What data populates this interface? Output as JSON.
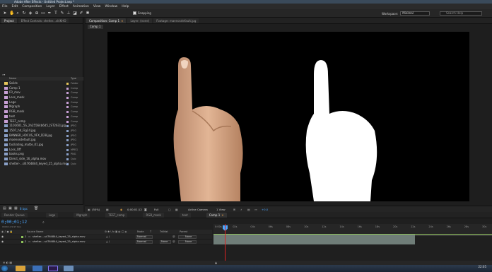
{
  "window": {
    "title": "Adobe After Effects - Untitled Project.aep *"
  },
  "menu": [
    "File",
    "Edit",
    "Composition",
    "Layer",
    "Effect",
    "Animation",
    "View",
    "Window",
    "Help"
  ],
  "toolbar": {
    "snapping_label": "Snapping",
    "workspace_label": "Workspace:",
    "workspace_value": "Minimal",
    "search_help_placeholder": "Search Help"
  },
  "project_tabs": {
    "project": "Project",
    "effect_controls": "Effect Controls: shelter...sl4KHO"
  },
  "project_columns": {
    "name": "Name",
    "type": "Type"
  },
  "project_items": [
    {
      "name": "Solids",
      "type": "Folder",
      "color": "#e6c65a",
      "icon": "folder-icon"
    },
    {
      "name": "Comp 1",
      "type": "Comp",
      "color": "#c8a0d6",
      "icon": "comp-icon"
    },
    {
      "name": "FR_mov",
      "type": "Comp",
      "color": "#c8a0d6",
      "icon": "comp-icon"
    },
    {
      "name": "Loss_mask",
      "type": "Comp",
      "color": "#c8a0d6",
      "icon": "comp-icon"
    },
    {
      "name": "Logo",
      "type": "Comp",
      "color": "#c8a0d6",
      "icon": "comp-icon"
    },
    {
      "name": "Mgraph",
      "type": "Comp",
      "color": "#c8a0d6",
      "icon": "comp-icon"
    },
    {
      "name": "RGB_mask",
      "type": "Comp",
      "color": "#c8a0d6",
      "icon": "comp-icon"
    },
    {
      "name": "text",
      "type": "Comp",
      "color": "#c8a0d6",
      "icon": "comp-icon"
    },
    {
      "name": "TEST_comp",
      "type": "Comp",
      "color": "#c8a0d6",
      "icon": "comp-icon"
    },
    {
      "name": "1101601_5S_2h25564b6d5_[ST263].jpg",
      "type": "JPEG",
      "color": "#8aa0c8",
      "icon": "image-icon"
    },
    {
      "name": "1507_hd_Fig24.jpg",
      "type": "JPEG",
      "color": "#8aa0c8",
      "icon": "image-icon"
    },
    {
      "name": "BANNER_HOCUS_VFX_D28.jpg",
      "type": "JPEG",
      "color": "#8aa0c8",
      "icon": "image-icon"
    },
    {
      "name": "maenosdefault.jpg",
      "type": "JPEG",
      "color": "#8aa0c8",
      "icon": "image-icon"
    },
    {
      "name": "faciliating_matte_01.jpg",
      "type": "JPEG",
      "color": "#8aa0c8",
      "icon": "image-icon"
    },
    {
      "name": "Loss_Off",
      "type": "MPEG",
      "color": "#8aa0c8",
      "icon": "video-icon"
    },
    {
      "name": "books.png",
      "type": "PNG",
      "color": "#8aa0c8",
      "icon": "image-icon"
    },
    {
      "name": "Direct_side_16_alpha.mov",
      "type": "Quic",
      "color": "#8aa0c8",
      "icon": "video-icon"
    },
    {
      "name": "shelter-...sl4764844_keyed_25_alpha.mov",
      "type": "Quic",
      "color": "#8aa0c8",
      "icon": "video-icon"
    }
  ],
  "project_footer": {
    "bpc": "8 bpc"
  },
  "comp_tabs": {
    "composition": "Composition: Comp 1",
    "layer": "Layer: (none)",
    "footage": "Footage: maenosdefault.jpg"
  },
  "comp_subtab": "Comp 1",
  "viewer_bar": {
    "zoom": "(50%)",
    "timecode": "0;00;01;12",
    "resolution": "Full",
    "camera": "Active Camera",
    "views": "1 View",
    "offset": "+0.0"
  },
  "timeline_tabs": [
    "Render Queue",
    "Logo",
    "Mgraph",
    "TEST_comp",
    "RGB_mask",
    "text",
    "Comp 1"
  ],
  "timeline": {
    "timecode": "0;00;01;12",
    "fps": "00042 (29.97 fps)",
    "columns": {
      "layer_name": "Source Name",
      "mode": "Mode",
      "trkmat": "TrkMat",
      "parent": "Parent",
      "t": "T"
    },
    "layers": [
      {
        "num": "1",
        "name": "shelter-...s4764844_keyed_25_alpha.mov",
        "mode": "Normal",
        "trkmat": "",
        "parent": "None"
      },
      {
        "num": "2",
        "name": "shelter-...s4764844_keyed_25_alpha.mov",
        "mode": "Normal",
        "trkmat": "None",
        "parent": "None"
      }
    ],
    "ruler_ticks": [
      "0:00s",
      "02s",
      "04s",
      "06s",
      "08s",
      "10s",
      "12s",
      "14s",
      "16s",
      "18s",
      "20s",
      "22s",
      "24s",
      "26s",
      "28s",
      "30s"
    ],
    "playhead_seconds": 1.4
  },
  "taskbar": {
    "time": "22:05",
    "date": ""
  },
  "colors": {
    "accent": "#4ba7ff",
    "playhead": "#dd2222",
    "layer_bar": "#6f7d78",
    "label_green": "#8ec35a"
  }
}
